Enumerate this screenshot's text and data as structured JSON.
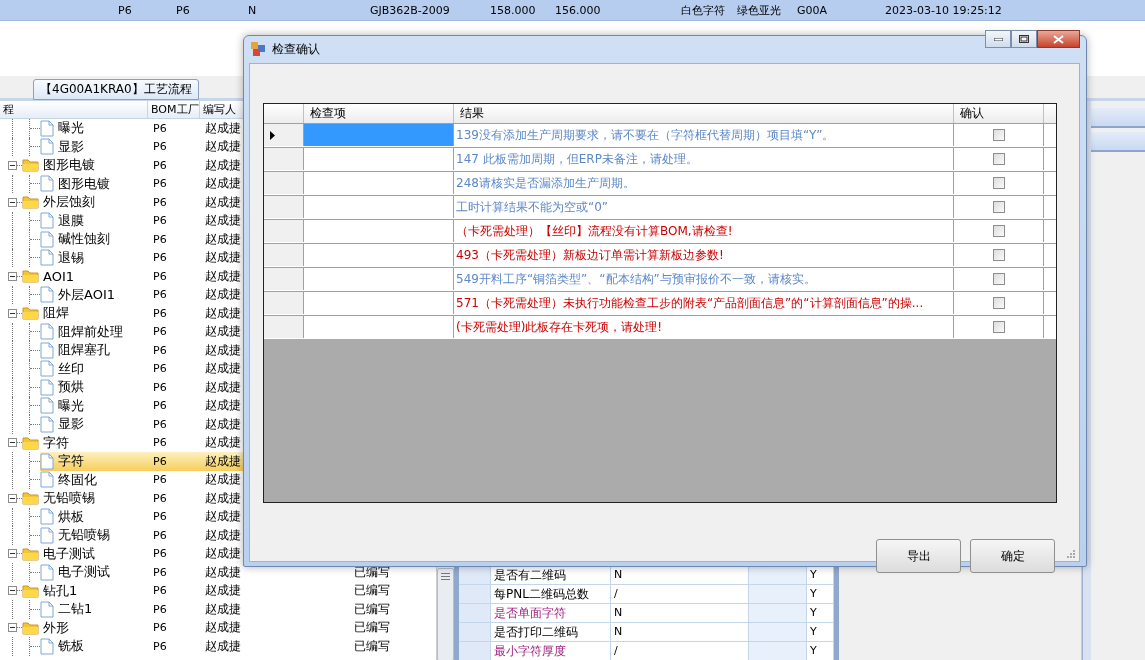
{
  "top_row": {
    "cells": [
      "P6",
      "P6",
      "N",
      "GJB362B-2009",
      "158.000",
      "156.000",
      "白色字符",
      "绿色亚光",
      "G00A",
      "2023-03-10 19:25:12"
    ]
  },
  "process_tab": {
    "label": "【4G00A1KRA0】工艺流程"
  },
  "tree_grid": {
    "columns": [
      "程",
      "BOM工厂",
      "编写人"
    ],
    "rows": [
      {
        "children": [
          {
            "label": "曝光",
            "kind": "file",
            "bom": "P6",
            "author": "赵成捷",
            "selected": false
          },
          {
            "label": "显影",
            "kind": "file",
            "bom": "P6",
            "author": "赵成捷",
            "selected": false
          }
        ]
      },
      {
        "label": "图形电镀",
        "kind": "folder",
        "bom": "P6",
        "author": "赵成捷",
        "selected": false,
        "expanded": true,
        "children": [
          {
            "label": "图形电镀",
            "kind": "file",
            "bom": "P6",
            "author": "赵成捷",
            "selected": false
          }
        ]
      },
      {
        "label": "外层蚀刻",
        "kind": "folder",
        "bom": "P6",
        "author": "赵成捷",
        "selected": false,
        "expanded": true,
        "children": [
          {
            "label": "退膜",
            "kind": "file",
            "bom": "P6",
            "author": "赵成捷",
            "selected": false
          },
          {
            "label": "碱性蚀刻",
            "kind": "file",
            "bom": "P6",
            "author": "赵成捷",
            "selected": false
          },
          {
            "label": "退锡",
            "kind": "file",
            "bom": "P6",
            "author": "赵成捷",
            "selected": false
          }
        ]
      },
      {
        "label": "AOI1",
        "kind": "folder",
        "bom": "P6",
        "author": "赵成捷",
        "selected": false,
        "expanded": true,
        "children": [
          {
            "label": "外层AOI1",
            "kind": "file",
            "bom": "P6",
            "author": "赵成捷",
            "selected": false
          }
        ]
      },
      {
        "label": "阻焊",
        "kind": "folder",
        "bom": "P6",
        "author": "赵成捷",
        "selected": false,
        "expanded": true,
        "children": [
          {
            "label": "阻焊前处理",
            "kind": "file",
            "bom": "P6",
            "author": "赵成捷",
            "selected": false
          },
          {
            "label": "阻焊塞孔",
            "kind": "file",
            "bom": "P6",
            "author": "赵成捷",
            "selected": false
          },
          {
            "label": "丝印",
            "kind": "file",
            "bom": "P6",
            "author": "赵成捷",
            "selected": false
          },
          {
            "label": "预烘",
            "kind": "file",
            "bom": "P6",
            "author": "赵成捷",
            "selected": false
          },
          {
            "label": "曝光",
            "kind": "file",
            "bom": "P6",
            "author": "赵成捷",
            "selected": false
          },
          {
            "label": "显影",
            "kind": "file",
            "bom": "P6",
            "author": "赵成捷",
            "selected": false
          }
        ]
      },
      {
        "label": "字符",
        "kind": "folder",
        "bom": "P6",
        "author": "赵成捷",
        "selected": false,
        "expanded": true,
        "children": [
          {
            "label": "字符",
            "kind": "file",
            "bom": "P6",
            "author": "赵成捷",
            "selected": true
          },
          {
            "label": "终固化",
            "kind": "file",
            "bom": "P6",
            "author": "赵成捷",
            "selected": false
          }
        ]
      },
      {
        "label": "无铅喷锡",
        "kind": "folder",
        "bom": "P6",
        "author": "赵成捷",
        "selected": false,
        "expanded": true,
        "children": [
          {
            "label": "烘板",
            "kind": "file",
            "bom": "P6",
            "author": "赵成捷",
            "selected": false
          },
          {
            "label": "无铅喷锡",
            "kind": "file",
            "bom": "P6",
            "author": "赵成捷",
            "selected": false
          }
        ]
      },
      {
        "label": "电子测试",
        "kind": "folder",
        "bom": "P6",
        "author": "赵成捷",
        "selected": false,
        "expanded": true,
        "children": [
          {
            "label": "电子测试",
            "kind": "file",
            "bom": "P6",
            "author": "赵成捷",
            "status": "已编写",
            "selected": false
          }
        ]
      },
      {
        "label": "钻孔1",
        "kind": "folder",
        "bom": "P6",
        "author": "赵成捷",
        "status": "已编写",
        "selected": false,
        "expanded": true,
        "children": [
          {
            "label": "二钻1",
            "kind": "file",
            "bom": "P6",
            "author": "赵成捷",
            "status": "已编写",
            "selected": false
          }
        ]
      },
      {
        "label": "外形",
        "kind": "folder",
        "bom": "P6",
        "author": "赵成捷",
        "status": "已编写",
        "selected": false,
        "expanded": true,
        "children": [
          {
            "label": "铣板",
            "kind": "file",
            "bom": "P6",
            "author": "赵成捷",
            "status": "已编写",
            "selected": false
          }
        ]
      }
    ]
  },
  "property_grid": {
    "rows": [
      {
        "name": "是否有二维码",
        "value": "N",
        "column_5": "Y",
        "emphasized": false
      },
      {
        "name": "每PNL二维码总数",
        "value": "/",
        "column_5": "Y",
        "emphasized": false
      },
      {
        "name": "是否单面字符",
        "value": "N",
        "column_5": "Y",
        "emphasized": true
      },
      {
        "name": "是否打印二维码",
        "value": "N",
        "column_5": "Y",
        "emphasized": false
      },
      {
        "name": "最小字符厚度",
        "value": "/",
        "column_5": "Y",
        "emphasized": true
      }
    ]
  },
  "dialog": {
    "title": "检查确认",
    "columns": [
      "检查项",
      "结果",
      "确认"
    ],
    "rows": [
      {
        "result": "139没有添加生产周期要求，请不要在（字符框代替周期）项目填“Y”。",
        "color": "#5b88c8",
        "confirmed": false,
        "selected": true
      },
      {
        "result": "147 此板需加周期，但ERP未备注，请处理。",
        "color": "#5b88c8",
        "confirmed": false,
        "selected": false
      },
      {
        "result": "248请核实是否漏添加生产周期。",
        "color": "#5b88c8",
        "confirmed": false,
        "selected": false
      },
      {
        "result": "工时计算结果不能为空或“0”",
        "color": "#5b88c8",
        "confirmed": false,
        "selected": false
      },
      {
        "result": "（卡死需处理）【丝印】流程没有计算BOM,请检查!",
        "color": "#cc0000",
        "confirmed": false,
        "selected": false
      },
      {
        "result": "493（卡死需处理）新板边订单需计算新板边参数!",
        "color": "#cc0000",
        "confirmed": false,
        "selected": false
      },
      {
        "result": "549开料工序“铜箔类型”、“配本结构”与预审报价不一致，请核实。",
        "color": "#5b88c8",
        "confirmed": false,
        "selected": false
      },
      {
        "result": "571（卡死需处理）未执行功能检查工步的附表“产品剖面信息”的“计算剖面信息”的操...",
        "color": "#cc0000",
        "confirmed": false,
        "selected": false
      },
      {
        "result": "(卡死需处理)此板存在卡死项，请处理!",
        "color": "#cc0000",
        "confirmed": false,
        "selected": false
      }
    ],
    "buttons": [
      "导出",
      "确定"
    ]
  }
}
